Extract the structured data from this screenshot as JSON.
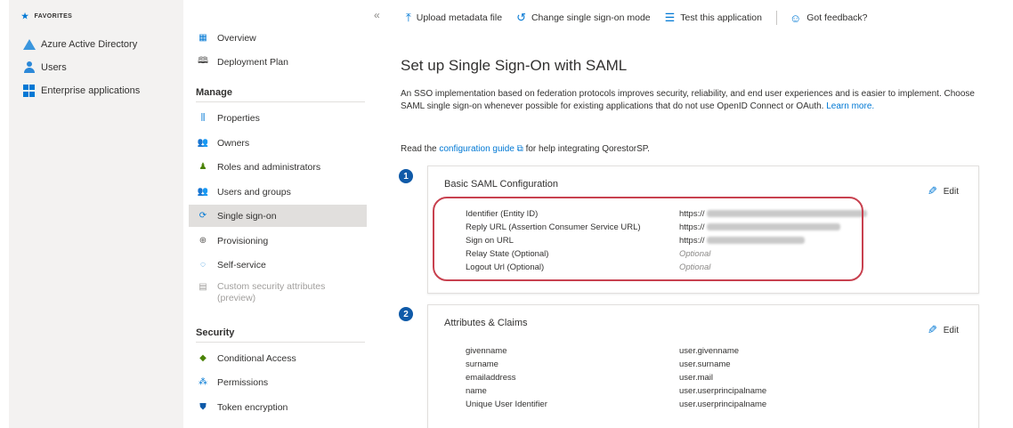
{
  "favorites": {
    "header": "FAVORITES",
    "items": [
      {
        "label": "Azure Active Directory",
        "icon": "azure-ad-icon"
      },
      {
        "label": "Users",
        "icon": "users-icon"
      },
      {
        "label": "Enterprise applications",
        "icon": "enterprise-apps-icon"
      }
    ]
  },
  "nav": {
    "collapse_glyph": "«",
    "top_items": [
      {
        "label": "Overview",
        "icon": "overview-icon"
      },
      {
        "label": "Deployment Plan",
        "icon": "book-icon"
      }
    ],
    "manage_header": "Manage",
    "manage_items": [
      {
        "label": "Properties",
        "icon": "properties-icon"
      },
      {
        "label": "Owners",
        "icon": "owners-icon"
      },
      {
        "label": "Roles and administrators",
        "icon": "roles-icon"
      },
      {
        "label": "Users and groups",
        "icon": "users-groups-icon"
      },
      {
        "label": "Single sign-on",
        "icon": "sso-icon",
        "selected": true
      },
      {
        "label": "Provisioning",
        "icon": "provisioning-icon"
      },
      {
        "label": "Self-service",
        "icon": "self-service-icon"
      }
    ],
    "disabled_item": {
      "line1": "Custom security attributes",
      "line2": "(preview)"
    },
    "security_header": "Security",
    "security_items": [
      {
        "label": "Conditional Access",
        "icon": "conditional-access-icon"
      },
      {
        "label": "Permissions",
        "icon": "permissions-icon"
      },
      {
        "label": "Token encryption",
        "icon": "token-encryption-icon"
      }
    ]
  },
  "toolbar": {
    "upload": "Upload metadata file",
    "change_mode": "Change single sign-on mode",
    "test": "Test this application",
    "feedback": "Got feedback?"
  },
  "main": {
    "title": "Set up Single Sign-On with SAML",
    "desc_text": "An SSO implementation based on federation protocols improves security, reliability, and end user experiences and is easier to implement. Choose SAML single sign-on whenever possible for existing applications that do not use OpenID Connect or OAuth.",
    "desc_link": "Learn more.",
    "read_prefix": "Read the",
    "read_link": "configuration guide",
    "read_suffix": "for help integrating QorestorSP."
  },
  "card1": {
    "step": "1",
    "title": "Basic SAML Configuration",
    "edit": "Edit",
    "rows": [
      {
        "key": "Identifier (Entity ID)",
        "value": "https://"
      },
      {
        "key": "Reply URL (Assertion Consumer Service URL)",
        "value": "https://"
      },
      {
        "key": "Sign on URL",
        "value": "https://"
      },
      {
        "key": "Relay State (Optional)",
        "value": "Optional"
      },
      {
        "key": "Logout Url (Optional)",
        "value": "Optional"
      }
    ]
  },
  "card2": {
    "step": "2",
    "title": "Attributes & Claims",
    "edit": "Edit",
    "rows": [
      {
        "key": "givenname",
        "value": "user.givenname"
      },
      {
        "key": "surname",
        "value": "user.surname"
      },
      {
        "key": "emailaddress",
        "value": "user.mail"
      },
      {
        "key": "name",
        "value": "user.userprincipalname"
      },
      {
        "key": "Unique User Identifier",
        "value": "user.userprincipalname"
      }
    ]
  },
  "colors": {
    "accent": "#0078d4",
    "highlight": "#c8414f",
    "selected_bg": "#e1dfdd"
  }
}
